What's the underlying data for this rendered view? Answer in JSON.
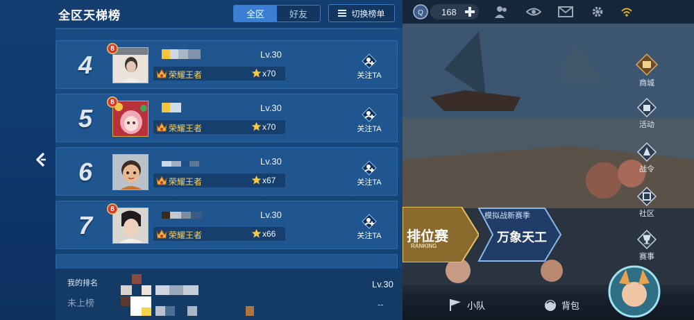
{
  "panel": {
    "title": "全区天梯榜",
    "scope_tabs": [
      {
        "label": "全区",
        "active": true
      },
      {
        "label": "好友",
        "active": false
      }
    ],
    "switch_label": "切换榜单"
  },
  "rows": [
    {
      "rank": "4",
      "level": "Lv.30",
      "tier": "荣耀王者",
      "stars": "x70",
      "follow": "关注TA",
      "vip": "8"
    },
    {
      "rank": "5",
      "level": "Lv.30",
      "tier": "荣耀王者",
      "stars": "x70",
      "follow": "关注TA",
      "vip": "8"
    },
    {
      "rank": "6",
      "level": "Lv.30",
      "tier": "荣耀王者",
      "stars": "x67",
      "follow": "关注TA",
      "vip": ""
    },
    {
      "rank": "7",
      "level": "Lv.30",
      "tier": "荣耀王者",
      "stars": "x66",
      "follow": "关注TA",
      "vip": "8"
    }
  ],
  "my_rank": {
    "label": "我的排名",
    "value": "未上榜",
    "level": "Lv.30",
    "stars": "--"
  },
  "game": {
    "coins": "168",
    "side_menu": [
      "商城",
      "活动",
      "战令",
      "社区",
      "赛事"
    ],
    "modes": {
      "ranked": "排位赛",
      "ranked_sub": "RANKING",
      "event": "万象天工",
      "event_tag": "模拟战新赛季"
    },
    "bottom": {
      "team": "小队",
      "bag": "背包"
    }
  },
  "colors": {
    "panel_bg": "#184679",
    "row_bg": "#1f568f",
    "tier_gold": "#f4d46a",
    "active_tab": "#3a7fd3"
  },
  "icons": [
    "back-chevron-icon",
    "list-icon",
    "crown-icon",
    "star-icon",
    "follow-plus-icon",
    "coin-icon",
    "plus-icon",
    "friends-icon",
    "eye-icon",
    "mail-icon",
    "gear-icon",
    "wifi-icon"
  ]
}
